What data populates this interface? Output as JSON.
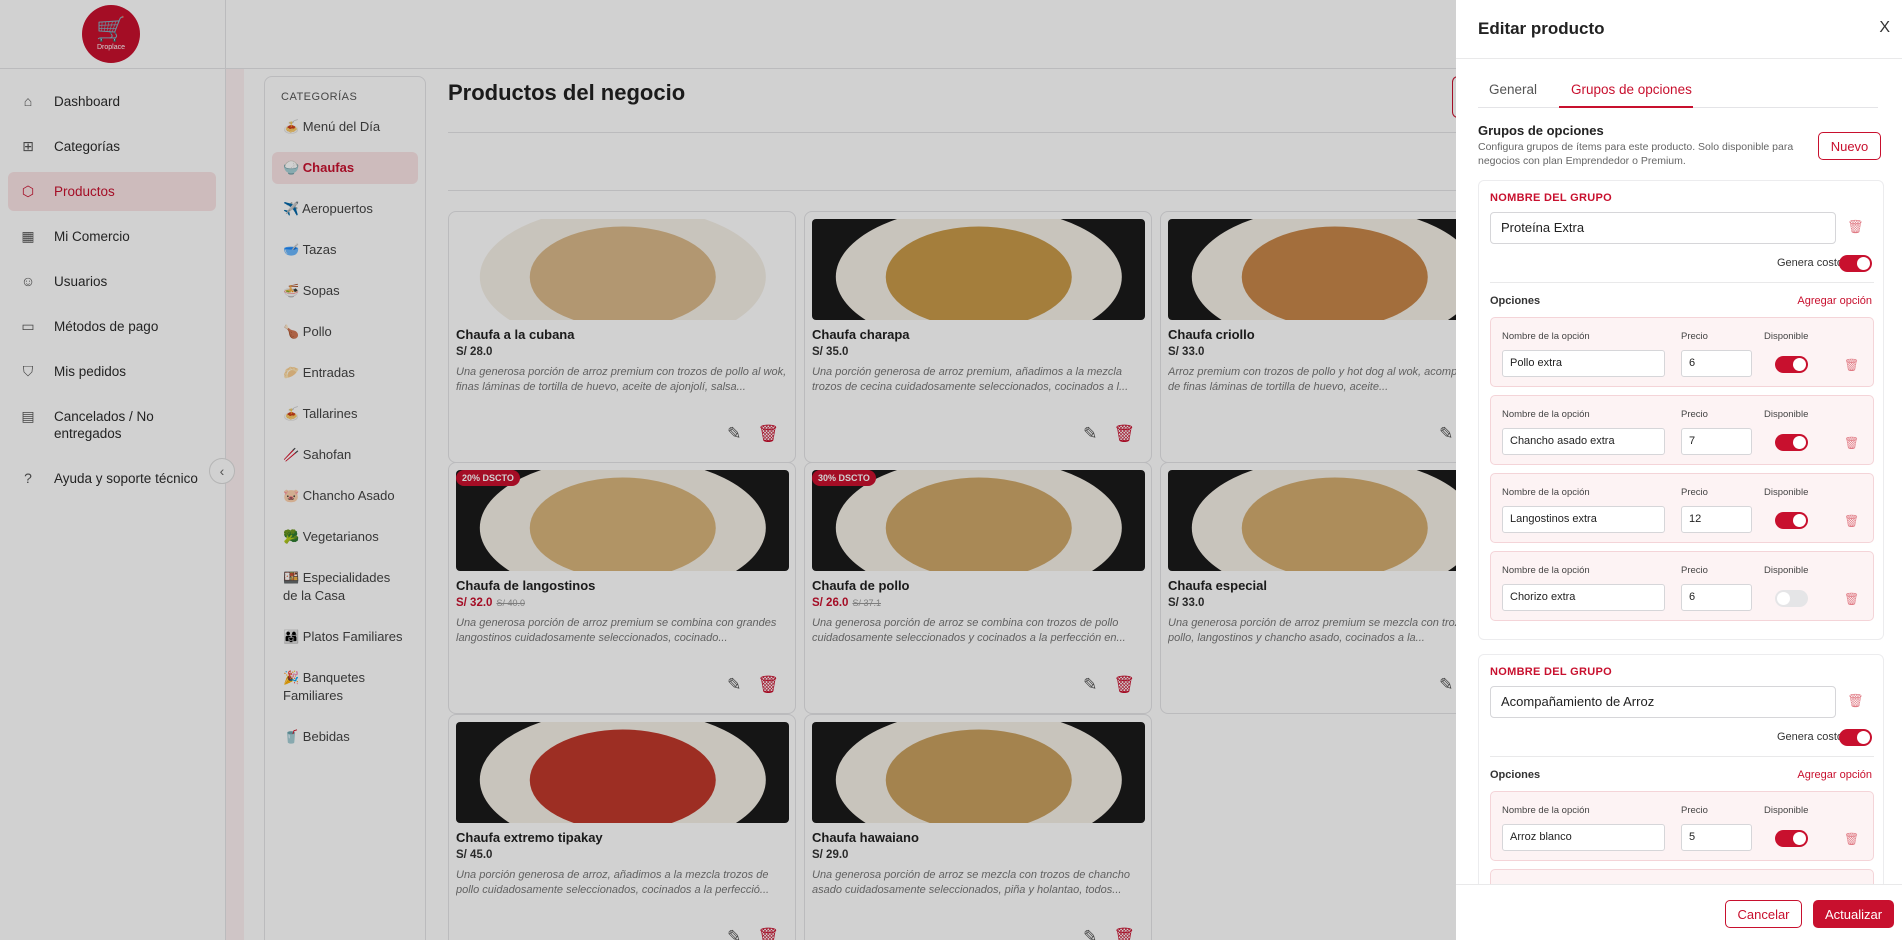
{
  "app": {
    "logo_text": "Droplace"
  },
  "nav": [
    {
      "label": "Dashboard",
      "icon": "home-icon",
      "glyph": "⌂",
      "active": false
    },
    {
      "label": "Categorías",
      "icon": "grid-icon",
      "glyph": "⊞",
      "active": false
    },
    {
      "label": "Productos",
      "icon": "box-icon",
      "glyph": "⬡",
      "active": true
    },
    {
      "label": "Mi Comercio",
      "icon": "store-icon",
      "glyph": "▦",
      "active": false
    },
    {
      "label": "Usuarios",
      "icon": "users-icon",
      "glyph": "☺",
      "active": false
    },
    {
      "label": "Métodos de pago",
      "icon": "credit-card-icon",
      "glyph": "▭",
      "active": false
    },
    {
      "label": "Mis pedidos",
      "icon": "shopping-bag-icon",
      "glyph": "⛉",
      "active": false
    },
    {
      "label": "Cancelados / No entregados",
      "icon": "document-x-icon",
      "glyph": "▤",
      "active": false
    },
    {
      "label": "Ayuda y soporte técnico",
      "icon": "help-circle-icon",
      "glyph": "?",
      "active": false
    }
  ],
  "categories": {
    "title": "CATEGORÍAS",
    "items": [
      {
        "label": "🍝 Menú del Día",
        "active": false
      },
      {
        "label": "🍚 Chaufas",
        "active": true
      },
      {
        "label": "✈️ Aeropuertos",
        "active": false
      },
      {
        "label": "🥣 Tazas",
        "active": false
      },
      {
        "label": "🍜 Sopas",
        "active": false
      },
      {
        "label": "🍗 Pollo",
        "active": false
      },
      {
        "label": "🥟 Entradas",
        "active": false
      },
      {
        "label": "🍝 Tallarines",
        "active": false
      },
      {
        "label": "🥢 Sahofan",
        "active": false
      },
      {
        "label": "🐷 Chancho Asado",
        "active": false
      },
      {
        "label": "🥦 Vegetarianos",
        "active": false
      },
      {
        "label": "🍱 Especialidades de la Casa",
        "active": false
      },
      {
        "label": "👨‍👩‍👧 Platos Familiares",
        "active": false
      },
      {
        "label": "🎉 Banquetes Familiares",
        "active": false
      },
      {
        "label": "🥤 Bebidas",
        "active": false
      }
    ]
  },
  "main": {
    "title": "Productos del negocio"
  },
  "products": [
    {
      "name": "Chaufa a la cubana",
      "price": "S/ 28.0",
      "old_price": "",
      "badge": "",
      "desc": "Una generosa porción de arroz premium con trozos de pollo al wok, finas láminas de tortilla de huevo, aceite de ajonjolí, salsa...",
      "food_color": "#d9b98a"
    },
    {
      "name": "Chaufa charapa",
      "price": "S/ 35.0",
      "old_price": "",
      "badge": "",
      "desc": "Una porción generosa de arroz premium, añadimos a la mezcla trozos de cecina cuidadosamente seleccionados, cocinados a l...",
      "food_color": "#c89a4a"
    },
    {
      "name": "Chaufa criollo",
      "price": "S/ 33.0",
      "old_price": "",
      "badge": "",
      "desc": "Arroz premium con trozos de pollo y hot dog al wok, acompañados de finas láminas de tortilla de huevo, aceite...",
      "food_color": "#c7874a"
    },
    {
      "name": "Chaufa de langostinos",
      "price": "S/ 32.0",
      "old_price": "S/ 40.0",
      "badge": "20% DSCTO",
      "desc": "Una generosa porción de arroz premium se combina con grandes langostinos cuidadosamente seleccionados, cocinado...",
      "food_color": "#d8b57c"
    },
    {
      "name": "Chaufa de pollo",
      "price": "S/ 26.0",
      "old_price": "S/ 37.1",
      "badge": "30% DSCTO",
      "desc": "Una generosa porción de arroz se combina con trozos de pollo cuidadosamente seleccionados y cocinados a la perfección en...",
      "food_color": "#cfa86a"
    },
    {
      "name": "Chaufa especial",
      "price": "S/ 33.0",
      "old_price": "",
      "badge": "",
      "desc": "Una generosa porción de arroz premium se mezcla con trozos de pollo, langostinos y chancho asado, cocinados a la...",
      "food_color": "#d3ad70"
    },
    {
      "name": "Chaufa extremo tipakay",
      "price": "S/ 45.0",
      "old_price": "",
      "badge": "",
      "desc": "Una porción generosa de arroz, añadimos a la mezcla trozos de pollo cuidadosamente seleccionados, cocinados a la perfecció...",
      "food_color": "#c0392b"
    },
    {
      "name": "Chaufa hawaiano",
      "price": "S/ 29.0",
      "old_price": "",
      "badge": "",
      "desc": "Una generosa porción de arroz se mezcla con trozos de chancho asado cuidadosamente seleccionados, piña y holantao, todos...",
      "food_color": "#c9a060"
    }
  ],
  "panel": {
    "title": "Editar producto",
    "close": "X",
    "tabs": [
      "General",
      "Grupos de opciones"
    ],
    "section_title": "Grupos de opciones",
    "section_desc": "Configura grupos de ítems para este producto. Solo disponible para negocios con plan Emprendedor o Premium.",
    "new_button": "Nuevo",
    "group_label": "NOMBRE DEL GRUPO",
    "cost_label": "Genera costo",
    "options_label": "Opciones",
    "add_option": "Agregar opción",
    "opt_name_label": "Nombre de la opción",
    "opt_price_label": "Precio",
    "opt_avail_label": "Disponible",
    "groups": [
      {
        "name": "Proteína Extra",
        "cost": true,
        "options": [
          {
            "name": "Pollo extra",
            "price": "6",
            "available": true
          },
          {
            "name": "Chancho asado extra",
            "price": "7",
            "available": true
          },
          {
            "name": "Langostinos extra",
            "price": "12",
            "available": true
          },
          {
            "name": "Chorizo extra",
            "price": "6",
            "available": false
          }
        ]
      },
      {
        "name": "Acompañamiento de Arroz",
        "cost": true,
        "options": [
          {
            "name": "Arroz blanco",
            "price": "5",
            "available": true
          },
          {
            "name": "",
            "price": "",
            "available": true
          }
        ]
      }
    ],
    "cancel": "Cancelar",
    "update": "Actualizar"
  }
}
